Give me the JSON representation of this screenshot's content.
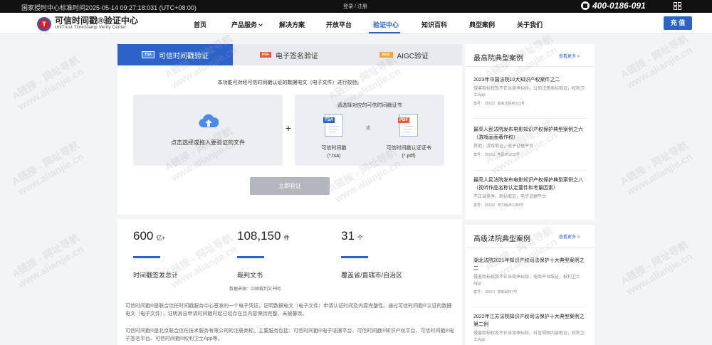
{
  "topbar": {
    "time_label": "国家授时中心标准时间2025-05-14 09:27:18:031 (UTC+08:00)",
    "login_links": "登录 / 注册",
    "phone": "400-0186-091"
  },
  "logo": {
    "mark": "T",
    "name_cn": "可信时间戳®验证中心",
    "name_en": "UniTrust TimeStamp Verify Center"
  },
  "nav": {
    "items": [
      {
        "label": "首页"
      },
      {
        "label": "产品服务"
      },
      {
        "label": "解决方案"
      },
      {
        "label": "开放平台"
      },
      {
        "label": "验证中心"
      },
      {
        "label": "知识百科"
      },
      {
        "label": "典型案例"
      },
      {
        "label": "关于我们"
      }
    ],
    "active_index": 4,
    "charge_label": "充 值",
    "accent_color": "#2d63c8"
  },
  "verify": {
    "tabs": [
      {
        "badge": "TSA",
        "label": "可信时间戳验证"
      },
      {
        "badge": "PDF",
        "label": "电子签名验证"
      },
      {
        "badge": "AIGC",
        "label": "AIGC验证"
      }
    ],
    "description": "本功能可对经可信时间戳认证的数据电文（电子文件）进行校验。",
    "upload_label": "点击选择或拖入要验证的文件",
    "cert_title": "请选择对应的可信时间戳证书",
    "or_label": "或",
    "cert_options": [
      {
        "tag": "TSA",
        "label": "可信时间戳",
        "ext": "(*.tsa)"
      },
      {
        "tag": "PDF",
        "label": "可信时间戳认证证书",
        "ext": "(*.pdf)"
      }
    ],
    "verify_button": "立即验证"
  },
  "stats": {
    "items": [
      {
        "value": "600",
        "unit": "亿+",
        "label": "时间戳签发总计"
      },
      {
        "value": "108,150",
        "unit": "件",
        "label": "裁判文书"
      },
      {
        "value": "31",
        "unit": "个",
        "label": "覆盖省/直辖市/自治区"
      }
    ],
    "source": "数据来源：中国裁判文书网",
    "paragraphs": [
      "可信时间戳®是联合信任时间戳服务中心签发的一个电子凭证，证明数据电文（电子文件）申请认证时间及内容完整性。通过可信时间戳®认证的数据电文（电子文件），证明其自申请时间戳时起已经存在且内容保持完整、未被篡改。",
      "可信时间戳®是北京联合信任技术服务有限公司的注册商标。主要服务包括：可信时间戳®电子证据平台、可信时间戳®知识产权平台、可信时间戳®电子签名平台、可信时间戳®权利卫士App等。"
    ]
  },
  "supreme_cases": {
    "title": "最高院典型案例",
    "more": "查看更多 >",
    "items": [
      {
        "title": "2023年中国法院10大知识产权案件之二",
        "desc": "侵害商标权及不正当竞争纠纷，公司注册商标取证，权利卫士App",
        "case_no": "案号：（2022）最高法民终313号"
      },
      {
        "title": "最高人民法院发布电影知识产权保护典型案例之六（游戏画面著作权）",
        "desc": "其他，游戏取证，电子证据平台",
        "case_no": "案号：（2021）粤民终1035号"
      },
      {
        "title": "最高人民法院发布电影知识产权保护典型案例之八（视听作品名称认定要件和考量因素）",
        "desc": "不正当竞争，商标取证，电子证据平台",
        "case_no": "案号：（2020）粤73民终2289号"
      }
    ]
  },
  "high_court_cases": {
    "title": "高级法院典型案例",
    "more": "查看更多 >",
    "items": [
      {
        "title": "湖北法院2021年知识产权司法保护十大典型案例之二",
        "desc": "侵害商标权及不正当竞争纠纷，电商平台取证，权利卫士App",
        "case_no": "案号：（2021）鄂知民终7号"
      },
      {
        "title": "2022年江苏法院知识产权司法保护十大典型案例之第二例",
        "desc": "侵害商标权及不正当竞争纠纷，抖音视频内容取证，权利卫士App",
        "case_no": ""
      }
    ]
  },
  "watermarks": [
    "A链接 - 网址导航",
    "www.alianjie.cn"
  ]
}
